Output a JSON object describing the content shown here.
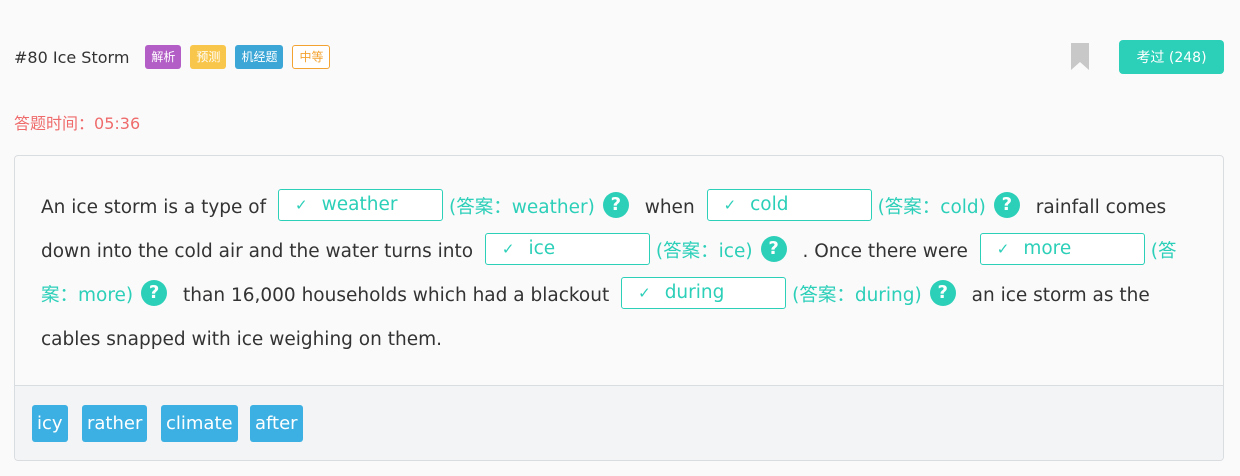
{
  "header": {
    "title": "#80 Ice Storm",
    "tags": [
      "解析",
      "预测",
      "机经题",
      "中等"
    ],
    "passed_label": "考过 (248)"
  },
  "timer": {
    "label": "答题时间：",
    "value": "05:36"
  },
  "passage": {
    "t1": "An ice storm is a type of",
    "b1": "weather",
    "a1": "(答案：weather)",
    "t2": "when",
    "b2": "cold",
    "a2": "(答案：cold)",
    "t3": "rainfall comes down into the cold air and the water turns into",
    "b3": "ice",
    "a3": "(答案：ice)",
    "t4": ". Once there were",
    "b4": "more",
    "a4": "(答案：more)",
    "t5": "than 16,000 households which had a blackout",
    "b5": "during",
    "a5": "(答案：during)",
    "t6": "an ice storm as the cables snapped with ice weighing on them.",
    "check": "✓",
    "help": "?"
  },
  "word_bank": [
    "icy",
    "rather",
    "climate",
    "after"
  ],
  "colors": {
    "accent": "#2ccfb8",
    "timer": "#ef6b6b",
    "chip": "#3cb0e2"
  }
}
